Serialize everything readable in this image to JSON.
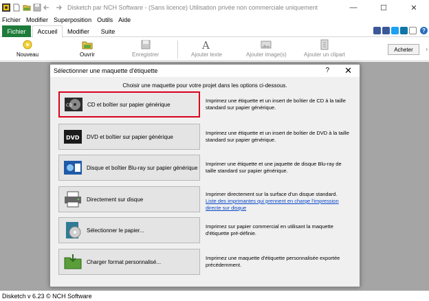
{
  "window": {
    "title": "Disketch par NCH Software - (Sans licence) Utilisation privée non commerciale uniquement",
    "minimize": "—",
    "maximize": "☐",
    "close": "✕"
  },
  "menu": [
    "Fichier",
    "Modifier",
    "Superposition",
    "Outils",
    "Aide"
  ],
  "tabs": {
    "fichier": "Fichier",
    "accueil": "Accueil",
    "modifier": "Modifier",
    "suite": "Suite"
  },
  "toolbar": {
    "nouveau": "Nouveau",
    "ouvrir": "Ouvrir",
    "enregistrer": "Enregistrer",
    "ajouter_texte": "Ajouter texte",
    "ajouter_image": "Ajouter image(s)",
    "ajouter_clipart": "Ajouter un clipart",
    "acheter": "Acheter"
  },
  "dialog": {
    "title": "Sélectionner une maquette d'étiquette",
    "help": "?",
    "close": "✕",
    "subtitle": "Choisir une maquette pour votre projet dans les options ci-dessous.",
    "options": [
      {
        "label": "CD et boîtier sur papier générique",
        "desc": "Imprimez une étiquette et un insert de boîtier de CD à la taille standard sur papier générique.",
        "link": ""
      },
      {
        "label": "DVD et boîtier sur papier générique",
        "desc": "Imprimez une étiquette et un insert de boîtier de DVD à la taille standard sur papier générique.",
        "link": ""
      },
      {
        "label": "Disque et boîtier Blu-ray sur papier générique",
        "desc": "Imprimer une étiquette et une jaquette de disque Blu-ray de taille standard sur papier générique.",
        "link": ""
      },
      {
        "label": "Directement sur disque",
        "desc": "Imprimer directement sur la surface d'un disque standard.",
        "link": "Liste des imprimantes qui prennent en charge l'impression directe sur disque"
      },
      {
        "label": "Sélectionner le papier...",
        "desc": "Imprimez sur papier commercial en utilisant la maquette d'étiquette pré-définie.",
        "link": ""
      },
      {
        "label": "Charger format personnalisé...",
        "desc": "Imprimez une maquette d'étiquette personnalisée exportée précédemment.",
        "link": ""
      }
    ]
  },
  "status": "Disketch v 6.23 © NCH Software",
  "colors": {
    "accent_green": "#1e7b3a",
    "selected_border": "#d9001b",
    "link": "#0645c8"
  }
}
